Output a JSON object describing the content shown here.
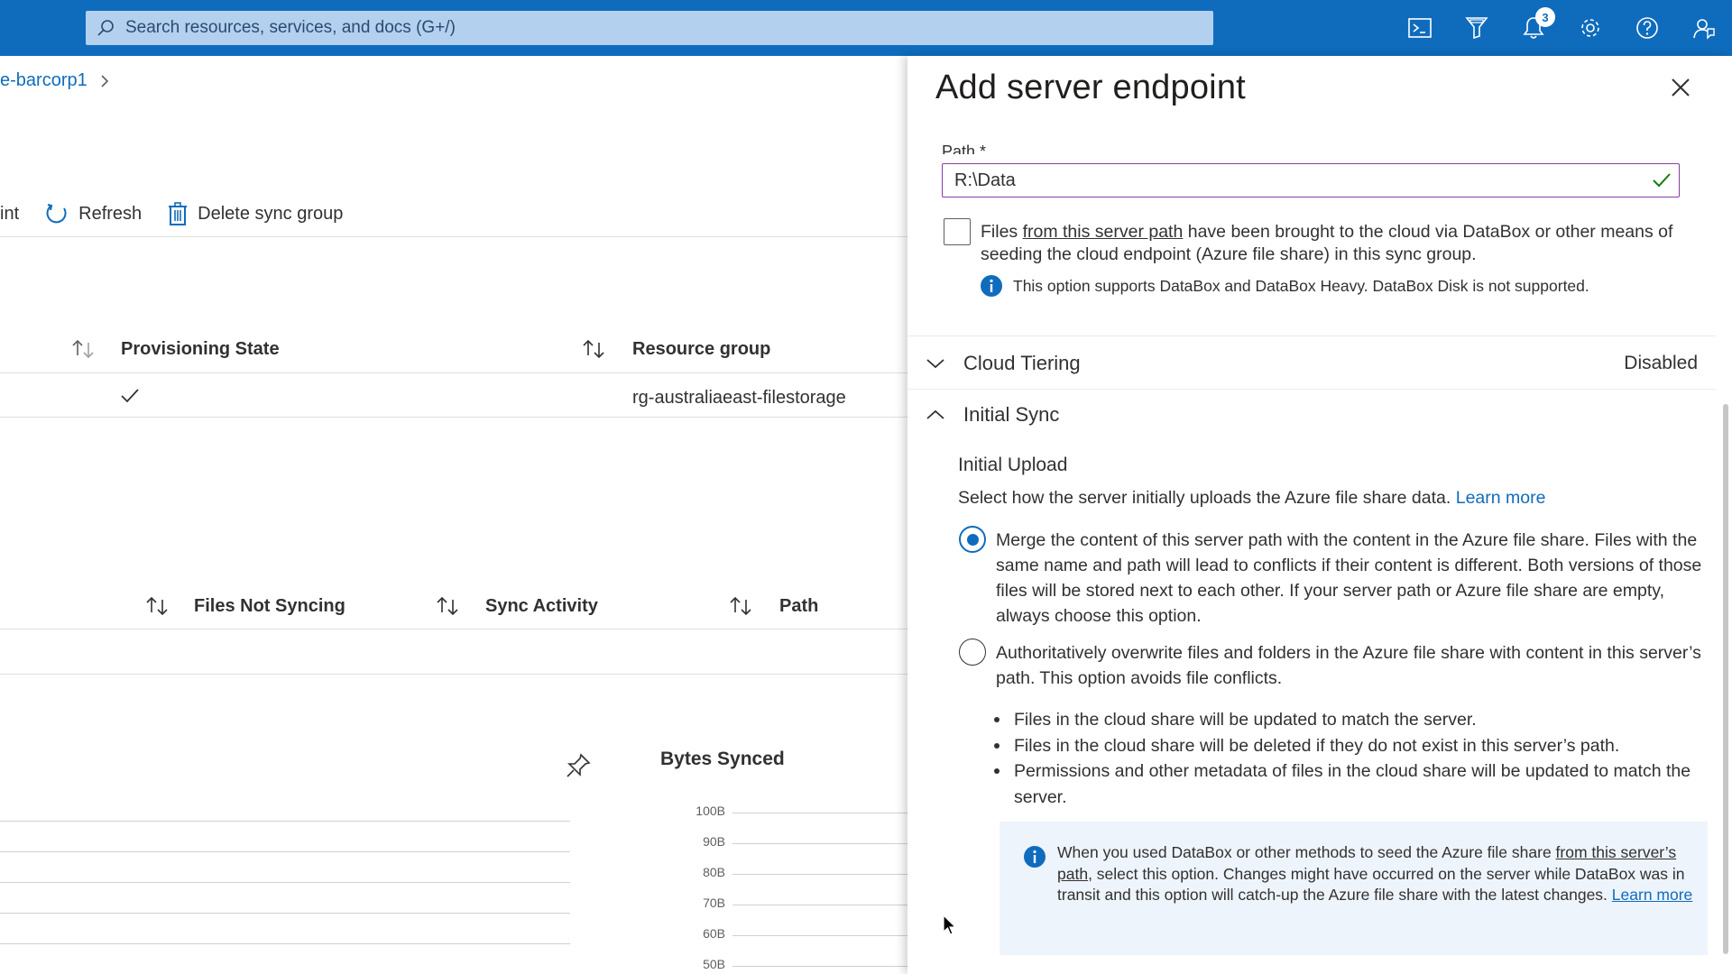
{
  "topbar": {
    "search_placeholder": "Search resources, services, and docs (G+/)",
    "notification_count": "3",
    "icons": [
      "cloud-shell-icon",
      "directory-filter-icon",
      "bell-icon",
      "gear-icon",
      "help-icon",
      "feedback-icon"
    ]
  },
  "background": {
    "breadcrumb": "e-barcorp1",
    "commands": {
      "point_fragment": "int",
      "refresh": "Refresh",
      "delete": "Delete sync group"
    },
    "table1": {
      "headers": [
        "Provisioning State",
        "Resource group"
      ],
      "row": {
        "resource_group": "rg-australiaeast-filestorage"
      }
    },
    "table2": {
      "headers": [
        "Files Not Syncing",
        "Sync Activity",
        "Path"
      ]
    },
    "chart": {
      "title": "Bytes Synced"
    }
  },
  "chart_data": {
    "type": "line",
    "title": "Bytes Synced",
    "y_ticks": [
      "100B",
      "90B",
      "80B",
      "70B",
      "60B",
      "50B"
    ],
    "series": []
  },
  "panel": {
    "title": "Add server endpoint",
    "path_label": "Path *",
    "path_value": "R:\\Data",
    "seed_checkbox": {
      "checked": false,
      "text_before": "Files ",
      "link": "from this server path",
      "text_after": " have been brought to the cloud via DataBox or other means of seeding the cloud endpoint (Azure file share) in this sync group."
    },
    "seed_info": "This option supports DataBox and DataBox Heavy. DataBox Disk is not supported.",
    "cloud_tiering": {
      "label": "Cloud Tiering",
      "status": "Disabled",
      "expanded": false
    },
    "initial_sync": {
      "label": "Initial Sync",
      "expanded": true
    },
    "initial_upload": {
      "heading": "Initial Upload",
      "description": "Select how the server initially uploads the Azure file share data.",
      "learn_more": "Learn more",
      "options": [
        {
          "selected": true,
          "text": "Merge the content of this server path with the content in the Azure file share. Files with the same name and path will lead to conflicts if their content is different. Both versions of those files will be stored next to each other. If your server path or Azure file share are empty, always choose this option."
        },
        {
          "selected": false,
          "text": "Authoritatively overwrite files and folders in the Azure file share with content in this server’s path. This option avoids file conflicts."
        }
      ],
      "bullets": [
        "Files in the cloud share will be updated to match the server.",
        "Files in the cloud share will be deleted if they do not exist in this server’s path.",
        "Permissions and other metadata of files in the cloud share will be updated to match the server."
      ],
      "info": {
        "text_before": "When you used DataBox or other methods to seed the Azure file share ",
        "link": "from this server’s path",
        "text_after": ", select this option. Changes might have occurred on the server while DataBox was in transit and this option will catch-up the Azure file share with the latest changes. ",
        "learn_more": "Learn more"
      }
    }
  },
  "colors": {
    "azure_blue": "#0f6cbd",
    "valid_green": "#107c10",
    "focus_purple": "#8a3ba8",
    "info_bg": "#eef4fc"
  }
}
